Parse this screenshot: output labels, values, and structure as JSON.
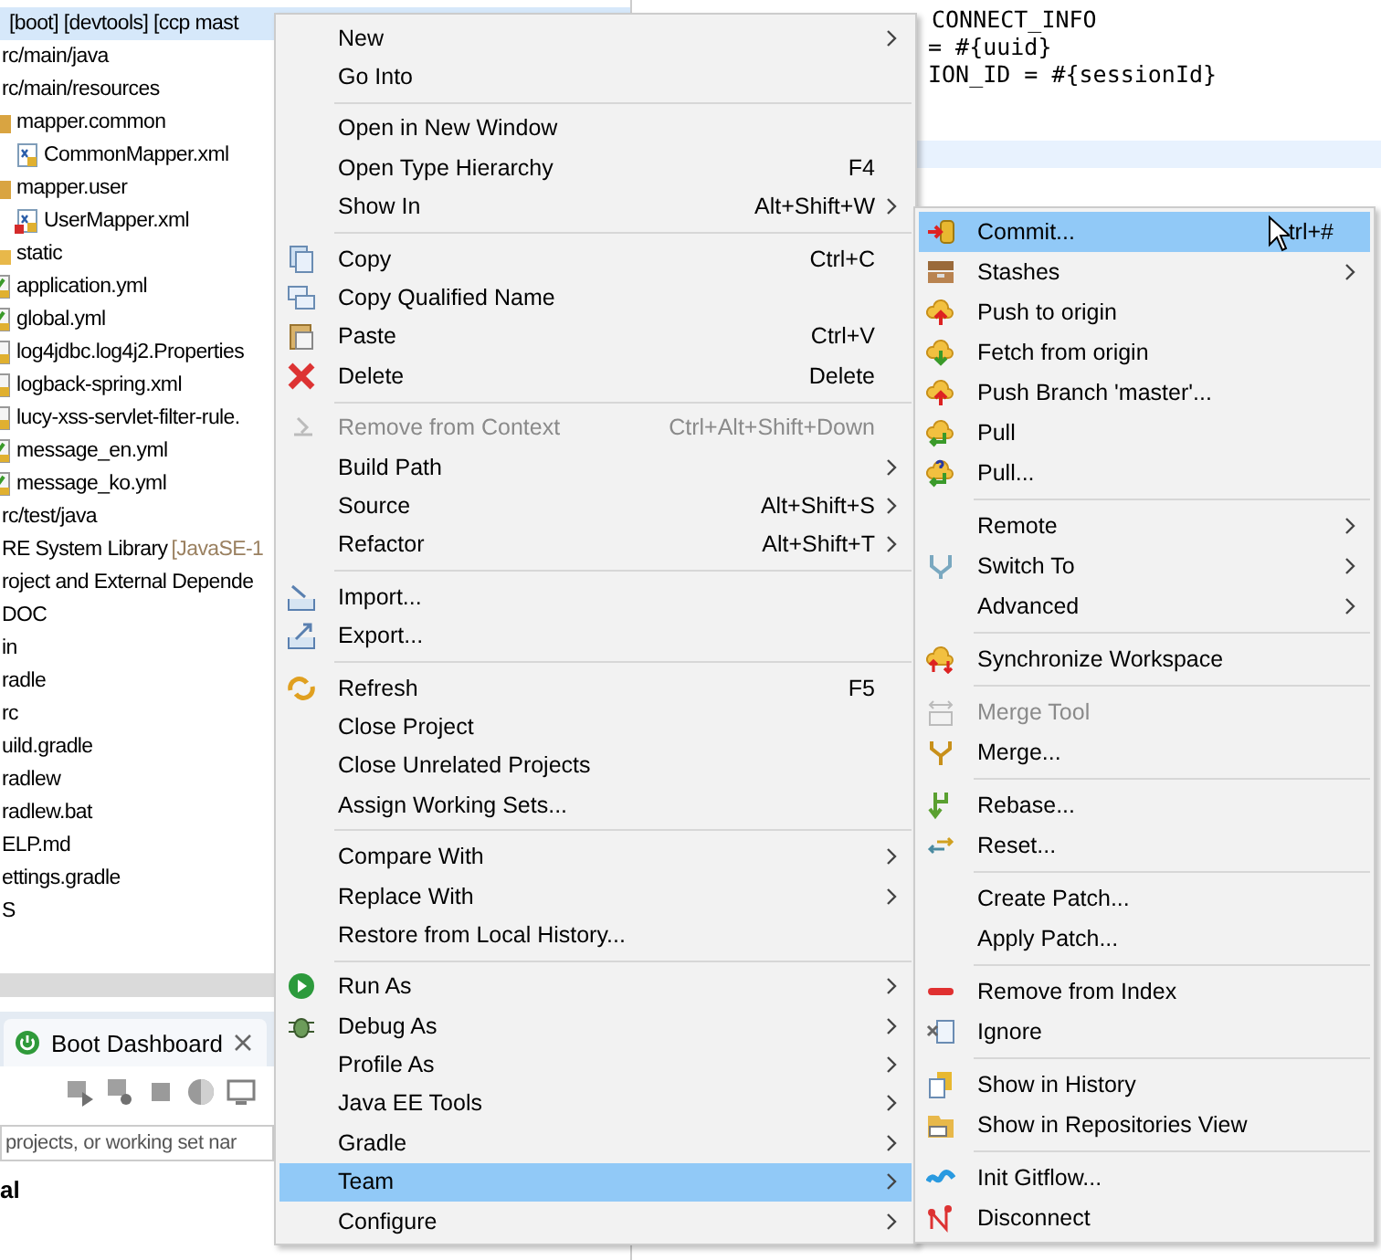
{
  "project_explorer": {
    "tree": [
      {
        "label": "[boot] [devtools] [ccp mast",
        "selected": true
      },
      {
        "label": "rc/main/java",
        "selected": false
      },
      {
        "label": "rc/main/resources",
        "selected": false,
        "children": [
          {
            "label": "mapper.common",
            "kind": "package",
            "selected": false,
            "children": [
              {
                "label": "CommonMapper.xml",
                "kind": "xml",
                "selected": false
              }
            ]
          },
          {
            "label": "mapper.user",
            "kind": "package",
            "selected": false,
            "children": [
              {
                "label": "UserMapper.xml",
                "kind": "xml-error",
                "selected": false
              }
            ]
          },
          {
            "label": "static",
            "kind": "folder",
            "selected": false
          },
          {
            "label": "application.yml",
            "kind": "yml",
            "selected": false
          },
          {
            "label": "global.yml",
            "kind": "yml",
            "selected": false
          },
          {
            "label": "log4jdbc.log4j2.Properties",
            "kind": "file",
            "selected": false
          },
          {
            "label": "logback-spring.xml",
            "kind": "file",
            "selected": false
          },
          {
            "label": "lucy-xss-servlet-filter-rule.",
            "kind": "file",
            "selected": false
          },
          {
            "label": "message_en.yml",
            "kind": "yml",
            "selected": false
          },
          {
            "label": "message_ko.yml",
            "kind": "yml",
            "selected": false
          }
        ]
      },
      {
        "label": "rc/test/java",
        "selected": false
      },
      {
        "label": "RE System Library",
        "decoration": "[JavaSE-1",
        "selected": false
      },
      {
        "label": "roject and External Depende",
        "selected": false
      },
      {
        "label": "DOC",
        "selected": false
      },
      {
        "label": "in",
        "selected": false
      },
      {
        "label": "radle",
        "selected": false
      },
      {
        "label": "rc",
        "selected": false
      },
      {
        "label": "uild.gradle",
        "selected": false
      },
      {
        "label": "radlew",
        "selected": false
      },
      {
        "label": "radlew.bat",
        "selected": false
      },
      {
        "label": "ELP.md",
        "selected": false
      },
      {
        "label": "ettings.gradle",
        "selected": false
      },
      {
        "label": "S",
        "selected": false
      }
    ]
  },
  "boot_dashboard": {
    "tab": "Boot Dashboard",
    "filter_placeholder": "projects, or working set nar",
    "group_label": "al"
  },
  "editor": {
    "lines": [
      "CONNECT_INFO",
      "= #{uuid}",
      "ION_ID = #{sessionId}"
    ]
  },
  "context_menu": {
    "groups": [
      {
        "items": [
          {
            "label": "New",
            "submenu": true,
            "disabled": false,
            "selected": false
          },
          {
            "label": "Go Into",
            "submenu": false,
            "disabled": false,
            "selected": false
          }
        ]
      },
      {
        "items": [
          {
            "label": "Open in New Window",
            "submenu": false,
            "disabled": false,
            "selected": false
          },
          {
            "label": "Open Type Hierarchy",
            "shortcut": "F4",
            "submenu": false,
            "disabled": false,
            "selected": false
          },
          {
            "label": "Show In",
            "shortcut": "Alt+Shift+W",
            "submenu": true,
            "disabled": false,
            "selected": false
          }
        ]
      },
      {
        "items": [
          {
            "label": "Copy",
            "shortcut": "Ctrl+C",
            "kind": "copy",
            "submenu": false,
            "disabled": false,
            "selected": false
          },
          {
            "label": "Copy Qualified Name",
            "kind": "copy-name",
            "submenu": false,
            "disabled": false,
            "selected": false
          },
          {
            "label": "Paste",
            "shortcut": "Ctrl+V",
            "kind": "paste",
            "submenu": false,
            "disabled": false,
            "selected": false
          },
          {
            "label": "Delete",
            "shortcut": "Delete",
            "kind": "delete",
            "submenu": false,
            "disabled": false,
            "selected": false
          }
        ]
      },
      {
        "items": [
          {
            "label": "Remove from Context",
            "shortcut": "Ctrl+Alt+Shift+Down",
            "kind": "remove-context",
            "submenu": false,
            "disabled": true,
            "selected": false
          },
          {
            "label": "Build Path",
            "submenu": true,
            "disabled": false,
            "selected": false
          },
          {
            "label": "Source",
            "shortcut": "Alt+Shift+S",
            "submenu": true,
            "disabled": false,
            "selected": false
          },
          {
            "label": "Refactor",
            "shortcut": "Alt+Shift+T",
            "submenu": true,
            "disabled": false,
            "selected": false
          }
        ]
      },
      {
        "items": [
          {
            "label": "Import...",
            "kind": "import",
            "submenu": false,
            "disabled": false,
            "selected": false
          },
          {
            "label": "Export...",
            "kind": "export",
            "submenu": false,
            "disabled": false,
            "selected": false
          }
        ]
      },
      {
        "items": [
          {
            "label": "Refresh",
            "shortcut": "F5",
            "kind": "refresh",
            "submenu": false,
            "disabled": false,
            "selected": false
          },
          {
            "label": "Close Project",
            "submenu": false,
            "disabled": false,
            "selected": false
          },
          {
            "label": "Close Unrelated Projects",
            "submenu": false,
            "disabled": false,
            "selected": false
          },
          {
            "label": "Assign Working Sets...",
            "submenu": false,
            "disabled": false,
            "selected": false
          }
        ]
      },
      {
        "items": [
          {
            "label": "Compare With",
            "submenu": true,
            "disabled": false,
            "selected": false
          },
          {
            "label": "Replace With",
            "submenu": true,
            "disabled": false,
            "selected": false
          },
          {
            "label": "Restore from Local History...",
            "submenu": false,
            "disabled": false,
            "selected": false
          }
        ]
      },
      {
        "items": [
          {
            "label": "Run As",
            "kind": "run",
            "submenu": true,
            "disabled": false,
            "selected": false
          },
          {
            "label": "Debug As",
            "kind": "debug",
            "submenu": true,
            "disabled": false,
            "selected": false
          },
          {
            "label": "Profile As",
            "submenu": true,
            "disabled": false,
            "selected": false
          },
          {
            "label": "Java EE Tools",
            "submenu": true,
            "disabled": false,
            "selected": false
          },
          {
            "label": "Gradle",
            "submenu": true,
            "disabled": false,
            "selected": false
          },
          {
            "label": "Team",
            "submenu": true,
            "disabled": false,
            "selected": true
          },
          {
            "label": "Configure",
            "submenu": true,
            "disabled": false,
            "selected": false
          }
        ]
      }
    ]
  },
  "team_submenu": {
    "groups": [
      {
        "items": [
          {
            "label": "Commit...",
            "shortcut": "trl+#",
            "kind": "commit",
            "submenu": false,
            "disabled": false,
            "selected": true
          },
          {
            "label": "Stashes",
            "kind": "stashes",
            "submenu": true,
            "disabled": false,
            "selected": false
          },
          {
            "label": "Push to origin",
            "kind": "push",
            "submenu": false,
            "disabled": false,
            "selected": false
          },
          {
            "label": "Fetch from origin",
            "kind": "fetch",
            "submenu": false,
            "disabled": false,
            "selected": false
          },
          {
            "label": "Push Branch 'master'...",
            "kind": "push",
            "submenu": false,
            "disabled": false,
            "selected": false
          },
          {
            "label": "Pull",
            "kind": "pull",
            "submenu": false,
            "disabled": false,
            "selected": false
          },
          {
            "label": "Pull...",
            "kind": "pull-dialog",
            "submenu": false,
            "disabled": false,
            "selected": false
          }
        ]
      },
      {
        "items": [
          {
            "label": "Remote",
            "submenu": true,
            "disabled": false,
            "selected": false
          },
          {
            "label": "Switch To",
            "kind": "switch",
            "submenu": true,
            "disabled": false,
            "selected": false
          },
          {
            "label": "Advanced",
            "submenu": true,
            "disabled": false,
            "selected": false
          }
        ]
      },
      {
        "items": [
          {
            "label": "Synchronize Workspace",
            "kind": "synchronize",
            "submenu": false,
            "disabled": false,
            "selected": false
          }
        ]
      },
      {
        "items": [
          {
            "label": "Merge Tool",
            "kind": "merge-tool",
            "submenu": false,
            "disabled": true,
            "selected": false
          },
          {
            "label": "Merge...",
            "kind": "merge",
            "submenu": false,
            "disabled": false,
            "selected": false
          }
        ]
      },
      {
        "items": [
          {
            "label": "Rebase...",
            "kind": "rebase",
            "submenu": false,
            "disabled": false,
            "selected": false
          },
          {
            "label": "Reset...",
            "kind": "reset",
            "submenu": false,
            "disabled": false,
            "selected": false
          }
        ]
      },
      {
        "items": [
          {
            "label": "Create Patch...",
            "submenu": false,
            "disabled": false,
            "selected": false
          },
          {
            "label": "Apply Patch...",
            "submenu": false,
            "disabled": false,
            "selected": false
          }
        ]
      },
      {
        "items": [
          {
            "label": "Remove from Index",
            "kind": "remove-index",
            "submenu": false,
            "disabled": false,
            "selected": false
          },
          {
            "label": "Ignore",
            "kind": "ignore",
            "submenu": false,
            "disabled": false,
            "selected": false
          }
        ]
      },
      {
        "items": [
          {
            "label": "Show in History",
            "kind": "history",
            "submenu": false,
            "disabled": false,
            "selected": false
          },
          {
            "label": "Show in Repositories View",
            "kind": "repositories",
            "submenu": false,
            "disabled": false,
            "selected": false
          }
        ]
      },
      {
        "items": [
          {
            "label": "Init Gitflow...",
            "kind": "gitflow",
            "submenu": false,
            "disabled": false,
            "selected": false
          },
          {
            "label": "Disconnect",
            "kind": "disconnect",
            "submenu": false,
            "disabled": false,
            "selected": false
          }
        ]
      }
    ]
  }
}
